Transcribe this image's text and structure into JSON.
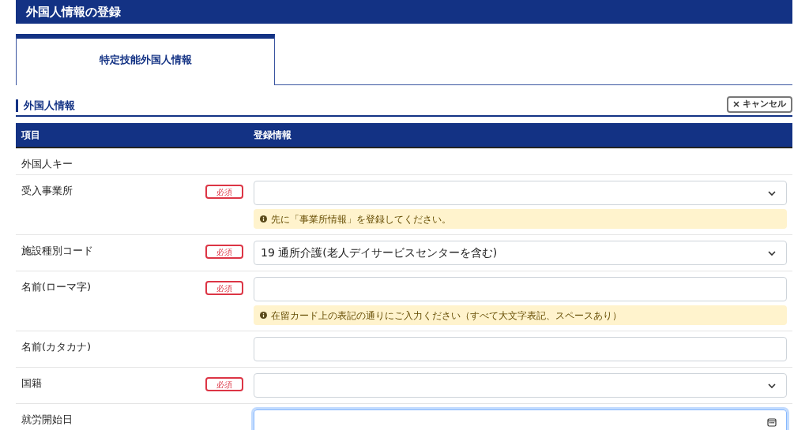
{
  "page_title": "外国人情報の登録",
  "tabs": [
    {
      "label": "特定技能外国人情報",
      "selected": true
    }
  ],
  "section": {
    "title": "外国人情報",
    "cancel_button": "キャンセル"
  },
  "table": {
    "columns": [
      "項目",
      "登録情報"
    ],
    "rows": [
      {
        "label": "外国人キー",
        "required": false,
        "kind": "none"
      },
      {
        "label": "受入事業所",
        "required": true,
        "required_label": "必須",
        "kind": "select",
        "value": "",
        "focused": false,
        "hint": "先に「事業所情報」を登録してください。"
      },
      {
        "label": "施設種別コード",
        "required": true,
        "required_label": "必須",
        "kind": "select",
        "value": "19 通所介護(老人デイサービスセンターを含む)",
        "focused": false
      },
      {
        "label": "名前(ローマ字)",
        "required": true,
        "required_label": "必須",
        "kind": "text",
        "value": "",
        "focused": false,
        "hint": "在留カード上の表記の通りにご入力ください（すべて大文字表記、スペースあり）"
      },
      {
        "label": "名前(カタカナ)",
        "required": false,
        "kind": "text",
        "value": "",
        "focused": false
      },
      {
        "label": "国籍",
        "required": true,
        "required_label": "必須",
        "kind": "select",
        "value": "",
        "focused": false
      },
      {
        "label": "就労開始日",
        "required": false,
        "kind": "date",
        "value": "",
        "focused": true
      }
    ]
  }
}
